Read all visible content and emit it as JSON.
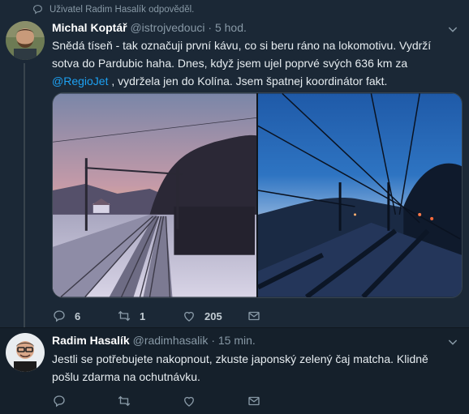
{
  "context": {
    "text": "Uživatel Radim Hasalík odpověděl."
  },
  "tweet1": {
    "name": "Michal Koptář",
    "handle": "@istrojvedouci",
    "separator": "·",
    "time": "5 hod.",
    "text_before": "Snědá tíseň - tak označuji první kávu, co si beru ráno na lokomotivu. Vydrží sotva do Pardubic haha. Dnes, když jsem ujel poprvé svých 636 km za ",
    "mention": "@RegioJet",
    "text_after": " , vydržela jen do Kolína. Jsem špatnej koordinátor fakt.",
    "reply_count": "6",
    "retweet_count": "1",
    "like_count": "205"
  },
  "tweet2": {
    "name": "Radim Hasalík",
    "handle": "@radimhasalik",
    "separator": "·",
    "time": "15 min.",
    "text": "Jestli se potřebujete nakopnout, zkuste japonský zelený čaj matcha. Klidně pošlu zdarma na ochutnávku."
  },
  "colors": {
    "accent": "#1da1f2",
    "background": "#1b2836",
    "muted": "#8899a6"
  },
  "icons": [
    "comment-bubble-icon",
    "reply-icon",
    "retweet-icon",
    "like-heart-icon",
    "message-envelope-icon",
    "chevron-down-icon"
  ]
}
